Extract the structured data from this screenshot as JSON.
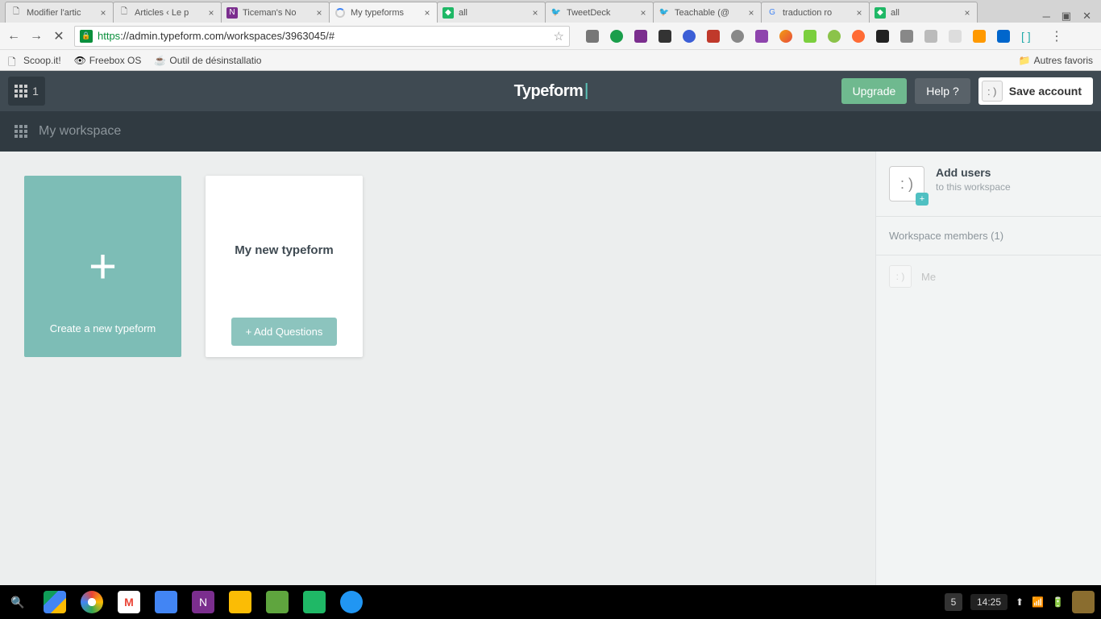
{
  "browser": {
    "tabs": [
      {
        "title": "Modifier l'artic"
      },
      {
        "title": "Articles ‹ Le p"
      },
      {
        "title": "Ticeman's No"
      },
      {
        "title": "My typeforms",
        "active": true
      },
      {
        "title": "all"
      },
      {
        "title": "TweetDeck"
      },
      {
        "title": "Teachable (@"
      },
      {
        "title": "traduction ro"
      },
      {
        "title": "all"
      }
    ],
    "url_scheme": "https",
    "url_host": "://admin.typeform.com/workspaces/3963045/#",
    "bookmarks": [
      "Scoop.it!",
      "Freebox OS",
      "Outil de désinstallatio"
    ],
    "other_bookmarks": "Autres favoris"
  },
  "header": {
    "workspace_count": "1",
    "logo": "Typeform",
    "upgrade": "Upgrade",
    "help": "Help ?",
    "save": "Save account"
  },
  "workspace_bar": {
    "title": "My workspace"
  },
  "cards": {
    "create_label": "Create a new typeform",
    "form_title": "My new typeform",
    "add_questions": "+ Add Questions"
  },
  "sidebar": {
    "add_users": "Add users",
    "add_users_sub": "to this workspace",
    "members_label": "Workspace members (1)",
    "me": "Me"
  },
  "taskbar": {
    "notif": "5",
    "clock": "14:25"
  }
}
